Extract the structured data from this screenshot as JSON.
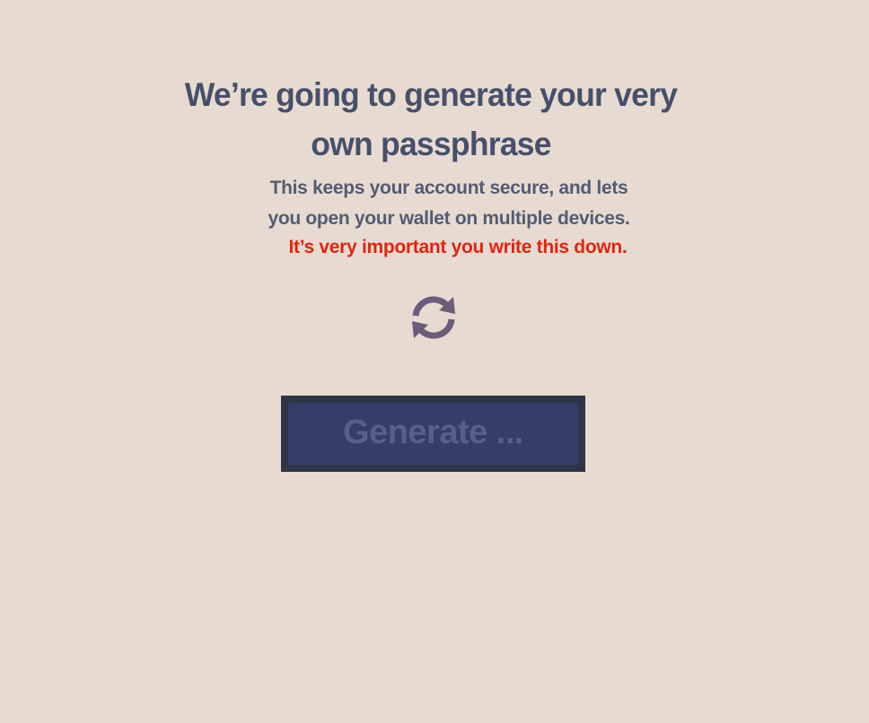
{
  "header": {
    "title": "We’re going to generate your very own passphrase"
  },
  "description": {
    "text": "This keeps your account secure, and lets you open your wallet on multiple devices.",
    "warning": "It’s very important you write this down."
  },
  "refresh": {
    "icon": "refresh-icon"
  },
  "actions": {
    "generate_label": "Generate ..."
  },
  "colors": {
    "background": "#e7dbd1",
    "title": "#46506a",
    "warning": "#e5220f",
    "icon": "#6a5c7a",
    "button_fill": "#363d66",
    "button_border": "#2e3547",
    "button_text": "#595e8c"
  }
}
